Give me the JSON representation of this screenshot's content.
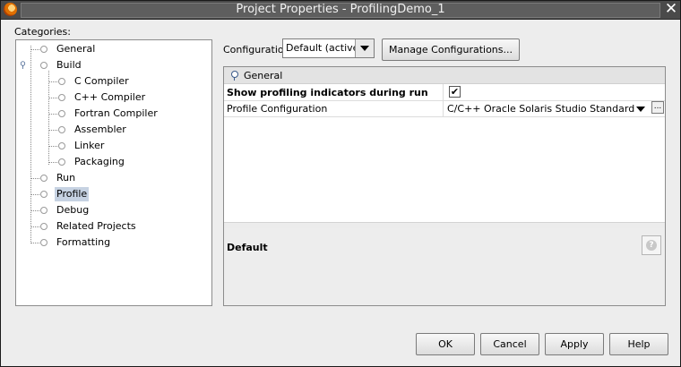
{
  "window": {
    "title": "Project Properties - ProfilingDemo_1"
  },
  "categories": {
    "label": "Categories:",
    "items": [
      {
        "label": "General"
      },
      {
        "label": "Build"
      },
      {
        "label": "C Compiler"
      },
      {
        "label": "C++ Compiler"
      },
      {
        "label": "Fortran Compiler"
      },
      {
        "label": "Assembler"
      },
      {
        "label": "Linker"
      },
      {
        "label": "Packaging"
      },
      {
        "label": "Run"
      },
      {
        "label": "Profile",
        "selected": true
      },
      {
        "label": "Debug"
      },
      {
        "label": "Related Projects"
      },
      {
        "label": "Formatting"
      }
    ]
  },
  "configuration": {
    "label": "Configuration:",
    "value": "Default (active)",
    "manage_button": "Manage Configurations..."
  },
  "properties": {
    "section_title": "General",
    "rows": [
      {
        "name": "Show profiling indicators during run",
        "checked": true,
        "check_glyph": "✔"
      },
      {
        "name": "Profile Configuration",
        "value": "C/C++ Oracle Solaris Studio Standard",
        "ellipsis": "..."
      }
    ],
    "description_title": "Default",
    "help_glyph": "?"
  },
  "buttons": {
    "ok": "OK",
    "cancel": "Cancel",
    "apply": "Apply",
    "help": "Help"
  },
  "icons": {
    "app": "app-logo-icon",
    "close": "close-icon",
    "help": "help-icon"
  }
}
